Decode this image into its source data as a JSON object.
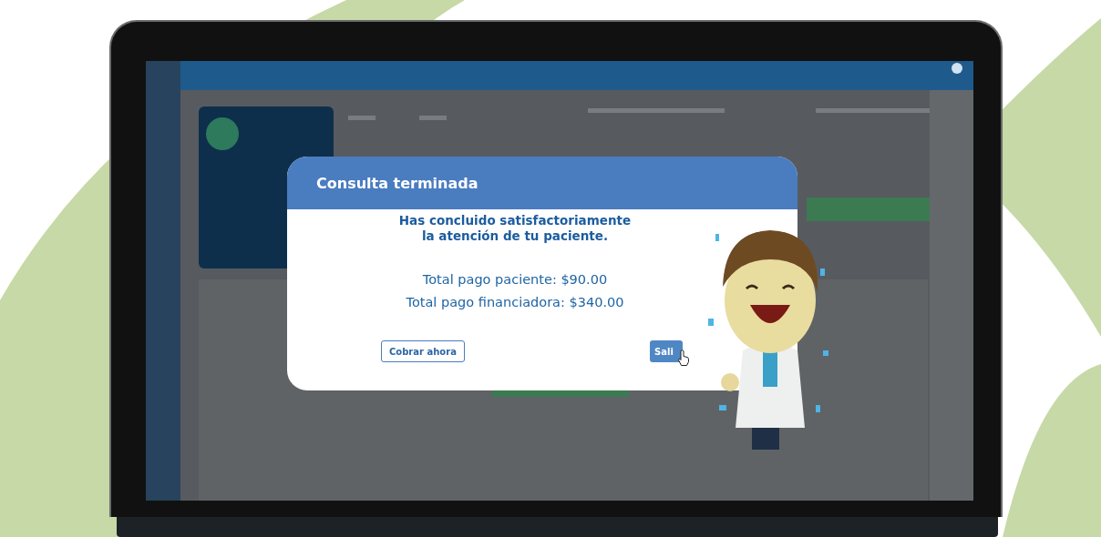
{
  "dialog": {
    "title": "Consulta terminada",
    "message_lines": [
      "Has concluido satisfactoriamente",
      "la atención de tu paciente."
    ],
    "totals": [
      "Total pago paciente: $90.00",
      "Total pago financiadora: $340.00"
    ],
    "buttons": [
      {
        "label": "Cobrar ahora",
        "kind": "secondary"
      },
      {
        "label": "Sali",
        "kind": "primary"
      }
    ]
  }
}
